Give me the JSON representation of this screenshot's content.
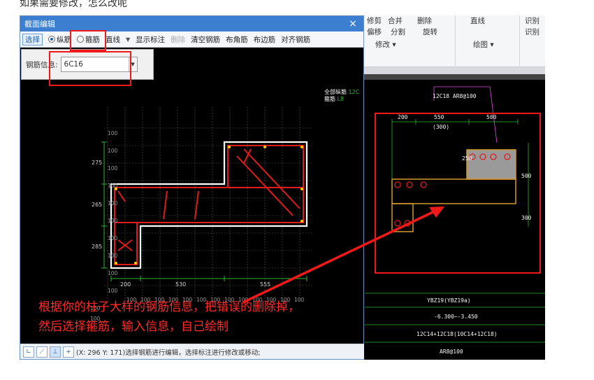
{
  "top_text": "如果需要修改，怎么改呢",
  "dialog": {
    "title": "截面编辑",
    "close_label": "×",
    "toolbar": {
      "select_label": "选择",
      "radio_longitudinal": "纵筋",
      "radio_stirrup": "箍筋",
      "line_label": "直线",
      "show_annotation": "显示标注",
      "delete_label": "删除",
      "clear_rebar": "清空钢筋",
      "corner_rebar": "布角筋",
      "edge_rebar": "布边筋",
      "align_rebar": "对齐钢筋"
    },
    "rebar_info_label": "钢筋信息:",
    "rebar_info_value": "6C16",
    "legend": {
      "line1": "全部纵筋",
      "line1_val": "12C",
      "line2": "箍筋",
      "line2_val": "L8"
    },
    "dims_left": [
      "275",
      "265",
      "285"
    ],
    "dims_bottom": [
      "200",
      "530",
      "555"
    ],
    "grid_labels": [
      "100",
      "100",
      "100",
      "100",
      "100",
      "100",
      "100",
      "100",
      "100",
      "100",
      "100",
      "100",
      "100"
    ],
    "grid_row_labels": [
      "100",
      "100",
      "100",
      "100",
      "100",
      "100",
      "100",
      "100",
      "100",
      "100",
      "100",
      "100"
    ],
    "status_text": "(X: 296 Y: 171)选择钢筋进行编辑，选择标注进行修改或移动;",
    "annotation": [
      "根据你的柱子大样的钢筋信息，把错误的删除掉，",
      "然后选择箍筋，输入信息，自己绘制"
    ]
  },
  "ribbon": {
    "items": [
      "修剪",
      "合并",
      "删除",
      "直线",
      "识别",
      "偏移",
      "分割",
      "旋转",
      "识别"
    ],
    "group_modify": "修改",
    "group_draw": "绘图"
  },
  "cad": {
    "header_label": "12C18 AR8@100",
    "dim_top": [
      "200",
      "550",
      "500"
    ],
    "dim_sub": "(300)",
    "dim_side": [
      "250",
      "500",
      "300"
    ],
    "table_rows": [
      "YBZ19(YBZ19a)",
      "-6.300~-3.450",
      "12C14+12C18(10C14+12C18)",
      "AR8@100"
    ]
  },
  "colors": {
    "title_bar": "#3c7fd0",
    "annotation_red": "#ff2a2a",
    "rebar_red": "#e01b1b",
    "dim_green": "#2db82d"
  }
}
